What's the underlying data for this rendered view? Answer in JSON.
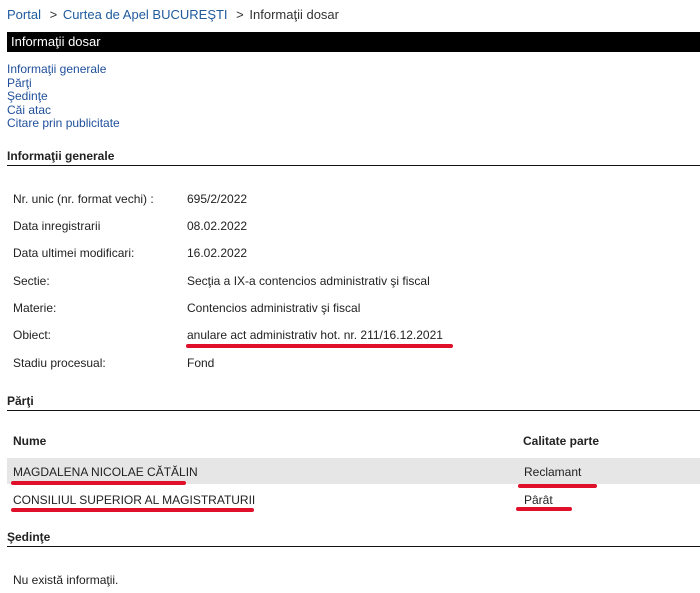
{
  "breadcrumb": {
    "items": [
      "Portal",
      "Curtea de Apel BUCUREŞTI"
    ],
    "separator": ">",
    "current": "Informaţii dosar"
  },
  "title": "Informaţii dosar",
  "nav": [
    "Informaţii generale",
    "Părţi",
    "Şedinţe",
    "Căi atac",
    "Citare prin publicitate"
  ],
  "general": {
    "heading": "Informaţii generale",
    "fields": [
      {
        "label": "Nr. unic (nr. format vechi) :",
        "value": "695/2/2022"
      },
      {
        "label": "Data inregistrarii",
        "value": "08.02.2022"
      },
      {
        "label": "Data ultimei modificari:",
        "value": "16.02.2022"
      },
      {
        "label": "Sectie:",
        "value": "Secţia a IX-a contencios administrativ şi fiscal"
      },
      {
        "label": "Materie:",
        "value": "Contencios administrativ şi fiscal"
      },
      {
        "label": "Obiect:",
        "value": "anulare act administrativ hot. nr. 211/16.12.2021"
      },
      {
        "label": "Stadiu procesual:",
        "value": "Fond"
      }
    ]
  },
  "parti": {
    "heading": "Părţi",
    "columns": [
      "Nume",
      "Calitate parte"
    ],
    "rows": [
      {
        "name": "MAGDALENA NICOLAE CĂTĂLIN",
        "role": "Reclamant"
      },
      {
        "name": "CONSILIUL SUPERIOR AL MAGISTRATURII",
        "role": "Pârât"
      }
    ]
  },
  "sedinte": {
    "heading": "Şedinţe",
    "empty": "Nu există informaţii."
  },
  "colors": {
    "link": "#1f4f9a",
    "title_bar": "#000000",
    "row_highlight": "#e6e6e6",
    "annotation": "#e0102a"
  }
}
